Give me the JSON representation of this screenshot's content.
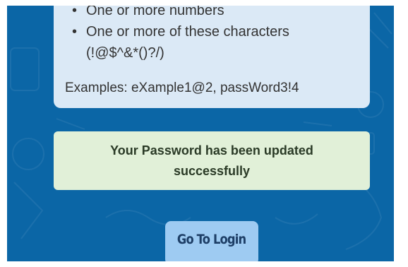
{
  "password_rules": {
    "items": [
      "One or more numbers",
      "One or more of these characters",
      "(!@$^&*()?/)"
    ],
    "examples": "Examples: eXample1@2, passWord3!4"
  },
  "status": {
    "message": "Your Password has been updated successfully"
  },
  "actions": {
    "login_label": "Go To Login"
  },
  "colors": {
    "background": "#0b66a6",
    "rules_card": "#dbe9f6",
    "success_box": "#e1f0d8",
    "button": "#9ecbf2"
  }
}
